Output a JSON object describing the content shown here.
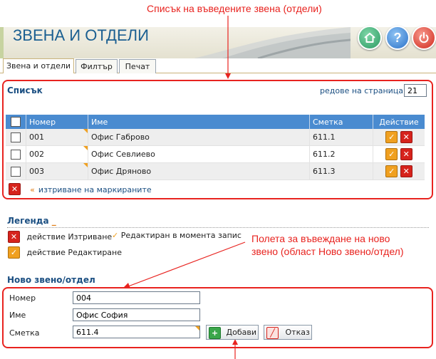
{
  "annotations": {
    "top": "Списък на въведените звена (отдели)",
    "right_line1": "Полета за въвеждане на ново",
    "right_line2": "звено (област Ново звено/отдел)"
  },
  "header": {
    "title": "ЗВЕНА И ОТДЕЛИ"
  },
  "icons": {
    "home": "home-icon",
    "help": "help-icon",
    "power": "power-icon"
  },
  "tabs": [
    {
      "label": "Звена и отдели",
      "active": true
    },
    {
      "label": "Филтър",
      "active": false
    },
    {
      "label": "Печат",
      "active": false
    }
  ],
  "list": {
    "title": "Списък",
    "rows_per_page_label": "редове на страница",
    "rows_per_page_marker": "»",
    "rows_per_page_value": "21",
    "columns": {
      "number": "Номер",
      "name": "Име",
      "account": "Сметка",
      "action": "Действие"
    },
    "rows": [
      {
        "number": "001",
        "name": "Офис Габрово",
        "account": "611.1"
      },
      {
        "number": "002",
        "name": "Офис Севлиево",
        "account": "611.2"
      },
      {
        "number": "003",
        "name": "Офис Дряново",
        "account": "611.3"
      }
    ],
    "delete_marker": "«",
    "delete_marked_label": "изтриване на маркираните"
  },
  "legend": {
    "title": "Легенда",
    "underscore": "_",
    "delete_action": "действие Изтриване",
    "edit_action": "действие Редактиране",
    "editing_now": "Редактиран в момента запис"
  },
  "new_unit": {
    "title": "Ново звено/отдел",
    "number_label": "Номер",
    "number_value": "004",
    "name_label": "Име",
    "name_value": "Офис София",
    "account_label": "Сметка",
    "account_value": "611.4",
    "add_button": "Добави",
    "cancel_button": "Отказ"
  },
  "colors": {
    "accent_red": "#e8231f",
    "title_blue": "#1b5f91",
    "table_header": "#4a8bd0"
  }
}
